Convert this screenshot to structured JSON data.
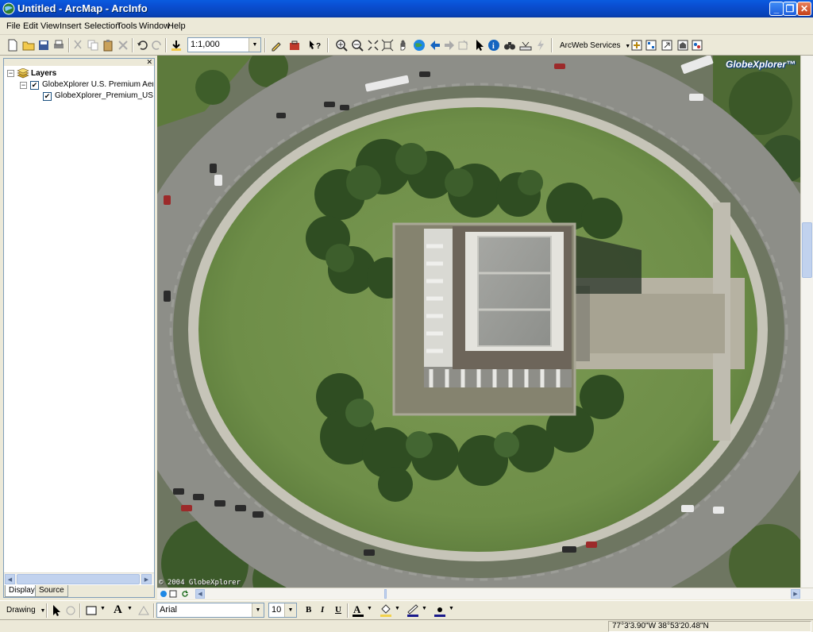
{
  "window": {
    "title": "Untitled - ArcMap - ArcInfo"
  },
  "menu": [
    "File",
    "Edit",
    "View",
    "Insert",
    "Selection",
    "Tools",
    "Window",
    "Help"
  ],
  "toolbar": {
    "scale_value": "1:1,000",
    "arcweb_label": "ArcWeb Services"
  },
  "toc": {
    "root_label": "Layers",
    "layer_label": "GlobeXplorer U.S. Premium Aerial Im",
    "sublayer_label": "GlobeXplorer_Premium_US",
    "tabs": [
      "Display",
      "Source"
    ]
  },
  "map": {
    "logo_text": "GlobeXplorer™",
    "copyright_text": "© 2004 GlobeXplorer"
  },
  "drawing": {
    "drawing_label": "Drawing",
    "font_value": "Arial",
    "size_value": "10",
    "bold": "B",
    "italic": "I",
    "underline": "U"
  },
  "status": {
    "coordinates": "77°3'3.90\"W  38°53'20.48\"N"
  },
  "colors": {
    "titlebar": "#0a4fd3",
    "grass": "#6f8f4a",
    "road": "#8f8f85"
  }
}
